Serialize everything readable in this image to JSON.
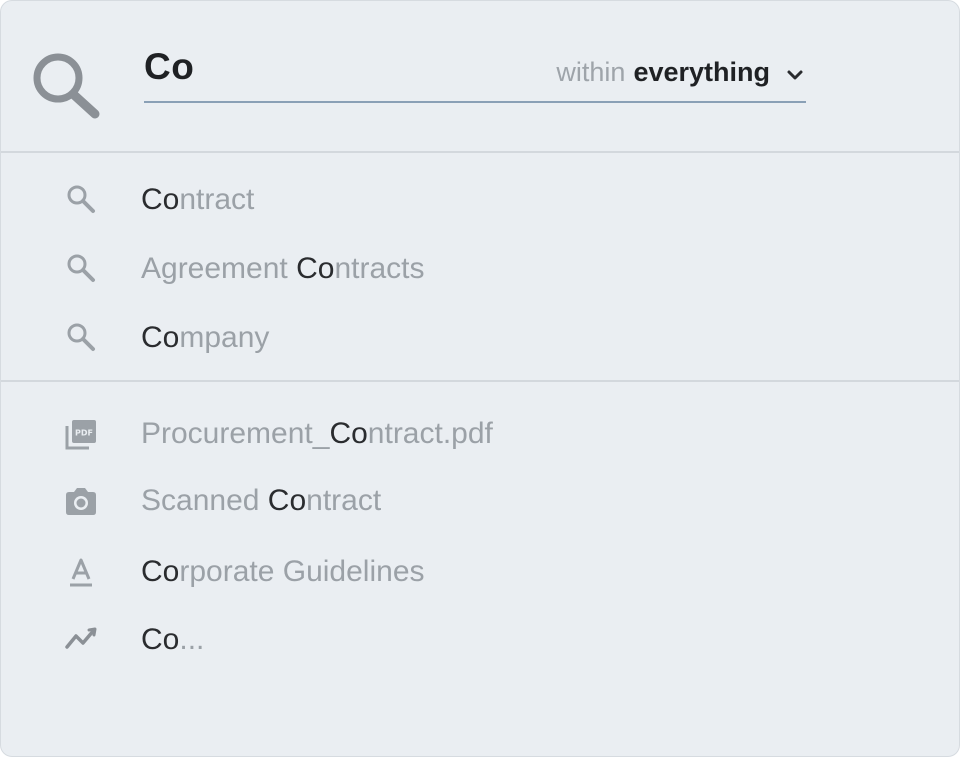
{
  "search": {
    "query": "Co",
    "scope_prefix": "within",
    "scope_value": "everything"
  },
  "query_suggestions": [
    {
      "icon": "search-icon",
      "before": "",
      "match": "Co",
      "after": "ntract"
    },
    {
      "icon": "search-icon",
      "before": "Agreement ",
      "match": "Co",
      "after": "ntracts"
    },
    {
      "icon": "search-icon",
      "before": "",
      "match": "Co",
      "after": "mpany"
    }
  ],
  "document_results": [
    {
      "icon": "pdf-icon",
      "before": "Procurement_",
      "match": "Co",
      "after": "ntract.pdf"
    },
    {
      "icon": "camera-icon",
      "before": "Scanned ",
      "match": "Co",
      "after": "ntract"
    },
    {
      "icon": "text-format-icon",
      "before": "",
      "match": "Co",
      "after": "rporate Guidelines"
    },
    {
      "icon": "trend-line-icon",
      "before": "",
      "match": "Co",
      "after": "..."
    }
  ],
  "colors": {
    "panel_background": "#eaeef2",
    "highlight_text": "#2a2c2f",
    "muted_text": "#9ba1a7",
    "underline": "#8aa0b6"
  }
}
